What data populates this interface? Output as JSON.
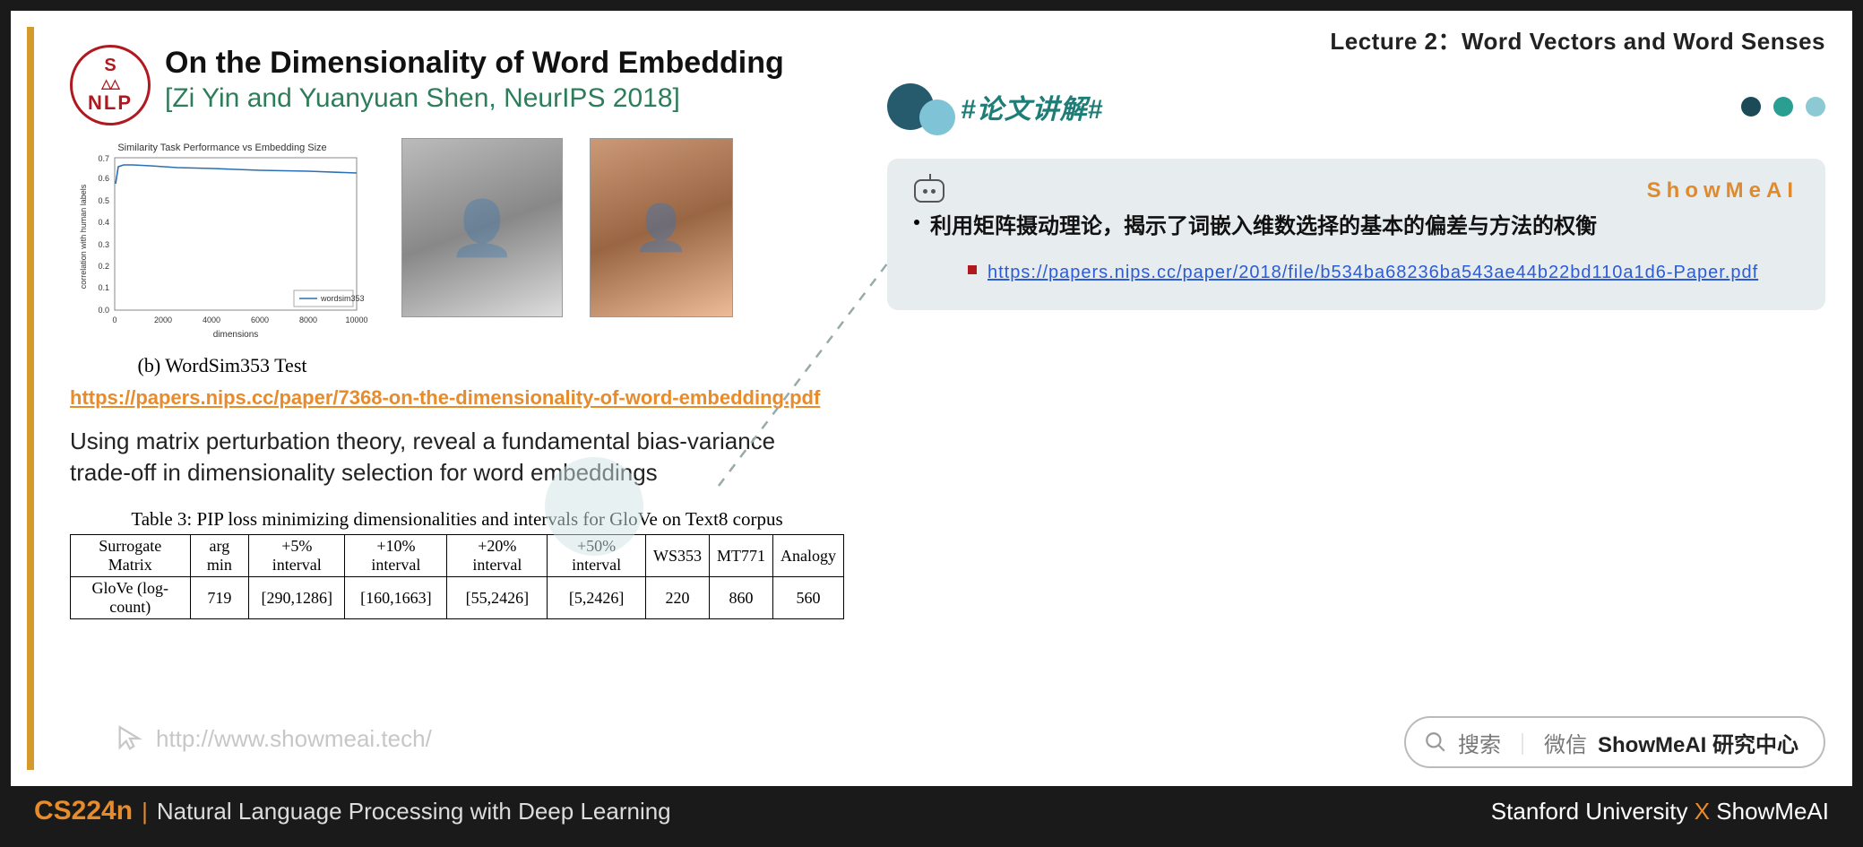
{
  "lecture_title": "Lecture 2：Word Vectors and Word Senses",
  "hash_tag": "#论文讲解#",
  "slide": {
    "logo": {
      "top": "S",
      "mid": "△△",
      "bot": "NLP"
    },
    "title": "On the Dimensionality of Word Embedding",
    "subtitle": "[Zi Yin and Yuanyuan Shen, NeurIPS 2018]",
    "chart_caption": "(b) WordSim353 Test",
    "paper_link": "https://papers.nips.cc/paper/7368-on-the-dimensionality-of-word-embedding.pdf",
    "description": "Using matrix perturbation theory, reveal a fundamental bias-variance trade-off in dimensionality selection for word embeddings",
    "table_caption": "Table 3: PIP loss minimizing dimensionalities and intervals for GloVe on Text8 corpus",
    "table": {
      "headers": [
        "Surrogate Matrix",
        "arg min",
        "+5% interval",
        "+10% interval",
        "+20% interval",
        "+50% interval",
        "WS353",
        "MT771",
        "Analogy"
      ],
      "rows": [
        [
          "GloVe (log-count)",
          "719",
          "[290,1286]",
          "[160,1663]",
          "[55,2426]",
          "[5,2426]",
          "220",
          "860",
          "560"
        ]
      ]
    },
    "watermark": "http://www.showmeai.tech/"
  },
  "card": {
    "brand": "ShowMeAI",
    "bullet": "利用矩阵摄动理论，揭示了词嵌入维数选择的基本的偏差与方法的权衡",
    "link_text": "https://papers.nips.cc/paper/2018/file/b534ba68236ba543ae44b22bd110a1d6-Paper.pdf"
  },
  "search": {
    "placeholder_a": "搜索",
    "placeholder_b": "微信",
    "bold": "ShowMeAI 研究中心"
  },
  "footer": {
    "course": "CS224n",
    "subtitle": "Natural Language Processing with Deep Learning",
    "right_a": "Stanford University",
    "right_x": "X",
    "right_b": "ShowMeAI"
  },
  "chart_data": {
    "type": "line",
    "title": "Similarity Task Performance vs Embedding Size",
    "xlabel": "dimensions",
    "ylabel": "correlation with human labels",
    "xlim": [
      0,
      10000
    ],
    "ylim": [
      0.0,
      0.7
    ],
    "legend": "wordsim353",
    "x": [
      50,
      100,
      200,
      400,
      800,
      1200,
      2000,
      4000,
      6000,
      8000,
      10000
    ],
    "y": [
      0.58,
      0.66,
      0.67,
      0.67,
      0.66,
      0.66,
      0.65,
      0.65,
      0.64,
      0.64,
      0.63
    ]
  }
}
